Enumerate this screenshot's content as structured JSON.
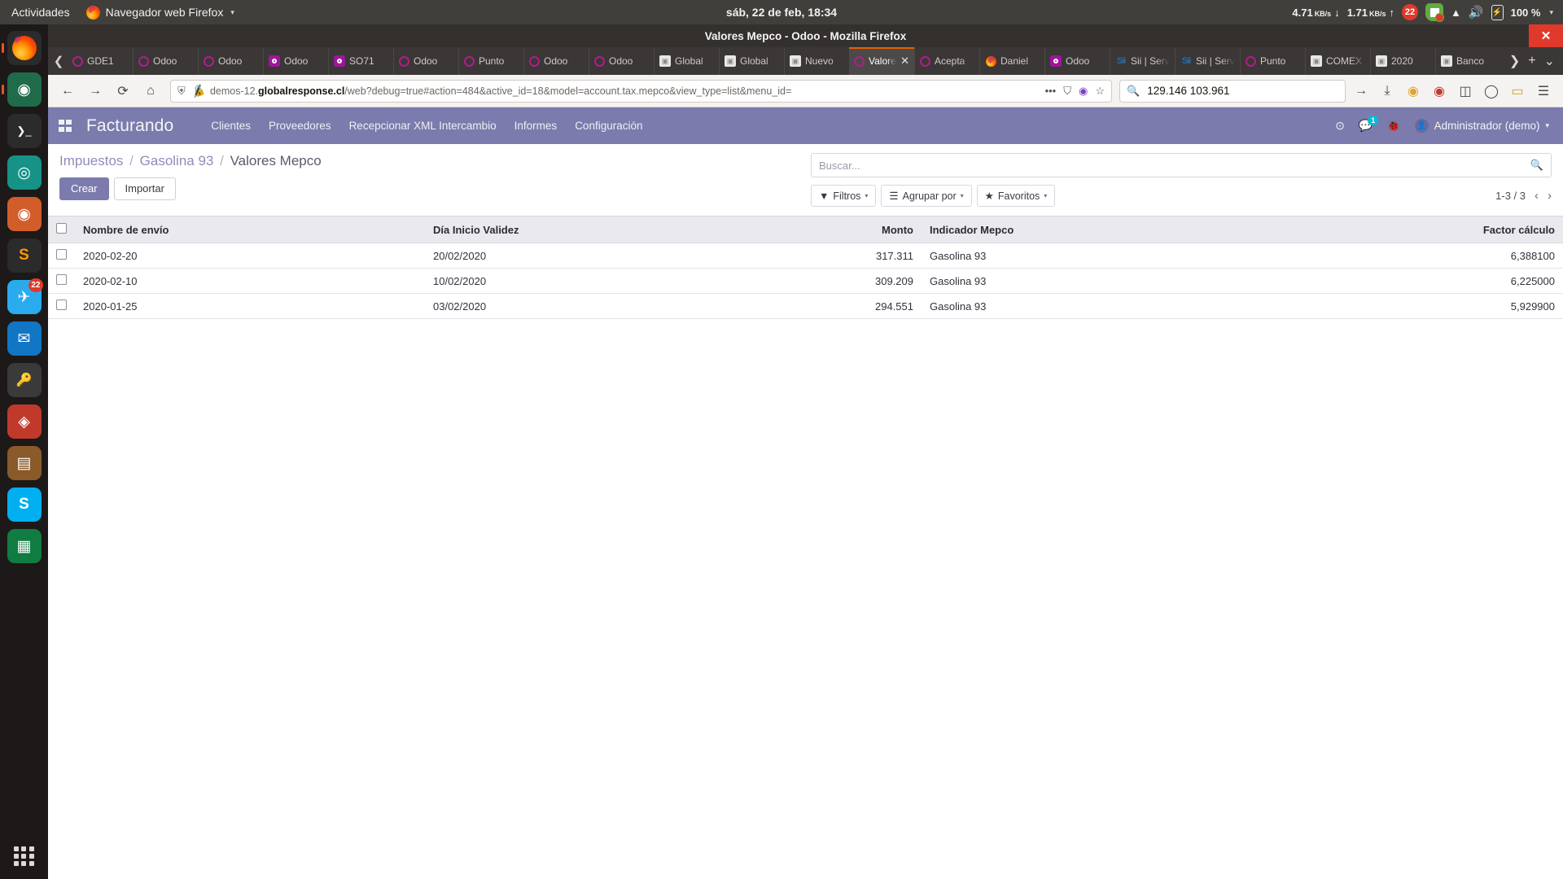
{
  "os_panel": {
    "activities": "Actividades",
    "app_name": "Navegador web Firefox",
    "clock": "sáb, 22 de feb, 18:34",
    "net_down_value": "4.71",
    "net_down_unit": "KB/s",
    "net_down_arrow": "↓",
    "net_up_value": "1.71",
    "net_up_unit": "KB/s",
    "net_up_arrow": "↑",
    "notification_count": "22",
    "shield_check": "✔",
    "battery_pct": "100 %",
    "caret": "▾"
  },
  "dock": {
    "items": [
      {
        "name": "firefox",
        "glyph": "",
        "color": "#e96d29",
        "badge": ""
      },
      {
        "name": "chromium",
        "glyph": "",
        "color": "#2a6b45",
        "badge": ""
      },
      {
        "name": "terminal",
        "glyph": "❯_",
        "color": "#2b2b2b",
        "badge": ""
      },
      {
        "name": "gitkraken",
        "glyph": "",
        "color": "#179287",
        "badge": ""
      },
      {
        "name": "ubuntu-software",
        "glyph": "",
        "color": "#e95420",
        "badge": ""
      },
      {
        "name": "sublime-text",
        "glyph": "S",
        "color": "#2b2b2b",
        "badge": ""
      },
      {
        "name": "telegram",
        "glyph": "✈",
        "color": "#2aabee",
        "badge": "22"
      },
      {
        "name": "thunderbird",
        "glyph": "✉",
        "color": "#1176c4",
        "badge": ""
      },
      {
        "name": "keepass",
        "glyph": "🔑",
        "color": "#3a3a3a",
        "badge": ""
      },
      {
        "name": "files-manager",
        "glyph": "◈",
        "color": "#d23a2a",
        "badge": ""
      },
      {
        "name": "archive-manager",
        "glyph": "▤",
        "color": "#8b5a2b",
        "badge": ""
      },
      {
        "name": "skype",
        "glyph": "S",
        "color": "#00aff0",
        "badge": ""
      },
      {
        "name": "libreoffice-calc",
        "glyph": "▦",
        "color": "#107c41",
        "badge": ""
      }
    ]
  },
  "firefox": {
    "window_title": "Valores Mepco - Odoo - Mozilla Firefox",
    "window_close": "✕",
    "tab_scroll_left": "❮",
    "tab_scroll_right": "❯",
    "new_tab": "+",
    "list_all_tabs": "⌄",
    "menu_button": "☰",
    "tabs": [
      {
        "label": "GDE1",
        "favicon": "odoo",
        "active": false
      },
      {
        "label": "Odoo",
        "favicon": "odoo",
        "active": false
      },
      {
        "label": "Odoo",
        "favicon": "odoo",
        "active": false
      },
      {
        "label": "Odoo",
        "favicon": "odoo-fill",
        "active": false
      },
      {
        "label": "SO71",
        "favicon": "odoo-fill",
        "active": false
      },
      {
        "label": "Odoo",
        "favicon": "odoo",
        "active": false
      },
      {
        "label": "Punto",
        "favicon": "odoo",
        "active": false
      },
      {
        "label": "Odoo",
        "favicon": "odoo",
        "active": false
      },
      {
        "label": "Odoo",
        "favicon": "odoo",
        "active": false
      },
      {
        "label": "Global",
        "favicon": "image",
        "active": false
      },
      {
        "label": "Global",
        "favicon": "image",
        "active": false
      },
      {
        "label": "Nuevo",
        "favicon": "image",
        "active": false
      },
      {
        "label": "Valores Mepco",
        "favicon": "odoo",
        "active": true
      },
      {
        "label": "Acepta",
        "favicon": "odoo",
        "active": false
      },
      {
        "label": "Daniel",
        "favicon": "firefox",
        "active": false
      },
      {
        "label": "Odoo",
        "favicon": "odoo-fill",
        "active": false
      },
      {
        "label": "Sii | Servicio",
        "favicon": "sii",
        "active": false
      },
      {
        "label": "Sii | Servicio",
        "favicon": "sii",
        "active": false
      },
      {
        "label": "Punto",
        "favicon": "odoo",
        "active": false
      },
      {
        "label": "COMEX",
        "favicon": "image",
        "active": false
      },
      {
        "label": "2020",
        "favicon": "image",
        "active": false
      },
      {
        "label": "Banco",
        "favicon": "image",
        "active": false
      }
    ],
    "nav": {
      "back": "←",
      "forward": "→",
      "reload": "⟳",
      "home": "⌂",
      "url_prefix": "demos-12.",
      "url_bold": "globalresponse.cl",
      "url_suffix": "/web?debug=true#action=484&active_id=18&model=account.tax.mepco&view_type=list&menu_id=",
      "page_actions": "•••",
      "pocket": "⛉",
      "container": "◉",
      "bookmark_star": "☆",
      "downloads": "⤓",
      "ext1": "◎",
      "ext2": "◉",
      "sidebar": "◫",
      "account": "◯",
      "library": "▭"
    },
    "search": {
      "value": "129.146   103.961",
      "magnifier": "🔍",
      "go": "→"
    }
  },
  "odoo": {
    "brand": "Facturando",
    "menu": [
      "Clientes",
      "Proveedores",
      "Recepcionar XML Intercambio",
      "Informes",
      "Configuración"
    ],
    "help_icon": "?",
    "chat_icon": "💬",
    "chat_count": "1",
    "debug_icon": "🐞",
    "user_label": "Administrador (demo)",
    "user_caret": "▾",
    "breadcrumb": {
      "items": [
        "Impuestos",
        "Gasolina 93"
      ],
      "current": "Valores Mepco",
      "separator": "/"
    },
    "buttons": {
      "create": "Crear",
      "import": "Importar"
    },
    "search": {
      "placeholder": "Buscar...",
      "value": ""
    },
    "filters": [
      {
        "label": "Filtros",
        "icon": "▼"
      },
      {
        "label": "Agrupar por",
        "icon": "☰"
      },
      {
        "label": "Favoritos",
        "icon": "★"
      }
    ],
    "pager": {
      "text": "1-3 / 3",
      "prev": "‹",
      "next": "›"
    },
    "table": {
      "headers": [
        "Nombre de envío",
        "Día Inicio Validez",
        "Monto",
        "Indicador Mepco",
        "Factor cálculo"
      ],
      "rows": [
        {
          "nombre": "2020-02-20",
          "dia": "20/02/2020",
          "monto": "317.311",
          "indicador": "Gasolina 93",
          "factor": "6,388100"
        },
        {
          "nombre": "2020-02-10",
          "dia": "10/02/2020",
          "monto": "309.209",
          "indicador": "Gasolina 93",
          "factor": "6,225000"
        },
        {
          "nombre": "2020-01-25",
          "dia": "03/02/2020",
          "monto": "294.551",
          "indicador": "Gasolina 93",
          "factor": "5,929900"
        }
      ]
    }
  }
}
